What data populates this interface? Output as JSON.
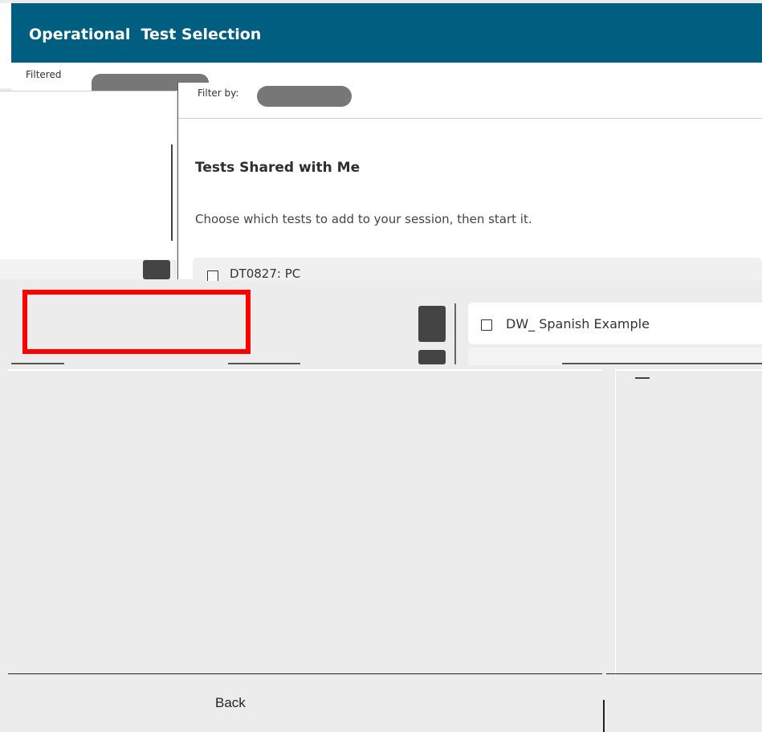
{
  "header": {
    "title": "Operational  Test Selection"
  },
  "filters": {
    "top_label": "Filtered",
    "center_label": "Filter by:"
  },
  "shared_tests": {
    "title": "Tests Shared with Me",
    "description": "Choose which tests to add to your session, then start it.",
    "items": [
      {
        "label": "DT0827: PC"
      },
      {
        "label": "DW_ Spanish Example"
      }
    ]
  },
  "footer": {
    "back_label": "Back"
  },
  "colors": {
    "header_bg": "#005e80",
    "highlight": "#ff0000"
  }
}
